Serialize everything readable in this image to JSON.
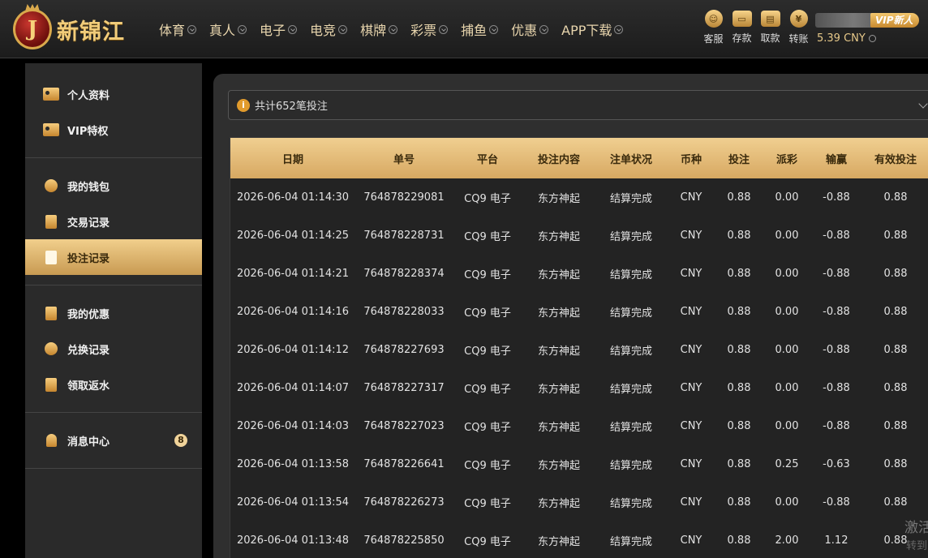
{
  "brand": {
    "logo_letter": "J",
    "name": "新锦江"
  },
  "nav": [
    {
      "label": "体育"
    },
    {
      "label": "真人"
    },
    {
      "label": "电子"
    },
    {
      "label": "电竞"
    },
    {
      "label": "棋牌"
    },
    {
      "label": "彩票"
    },
    {
      "label": "捕鱼"
    },
    {
      "label": "优惠"
    },
    {
      "label": "APP下载"
    }
  ],
  "actions": [
    {
      "label": "客服",
      "glyph": "☺"
    },
    {
      "label": "存款",
      "glyph": "▭"
    },
    {
      "label": "取款",
      "glyph": "▤"
    },
    {
      "label": "转账",
      "glyph": "¥"
    }
  ],
  "user": {
    "vip_badge": "VIP新人",
    "balance": "5.39 CNY"
  },
  "sidebar": {
    "groups": [
      [
        {
          "label": "个人资料",
          "icon": "id-card-icon"
        },
        {
          "label": "VIP特权",
          "icon": "vip-card-icon"
        }
      ],
      [
        {
          "label": "我的钱包",
          "icon": "wallet-icon"
        },
        {
          "label": "交易记录",
          "icon": "transaction-icon"
        },
        {
          "label": "投注记录",
          "icon": "bet-record-icon",
          "active": true
        }
      ],
      [
        {
          "label": "我的优惠",
          "icon": "gift-icon"
        },
        {
          "label": "兑换记录",
          "icon": "money-bag-icon"
        },
        {
          "label": "领取返水",
          "icon": "rebate-icon"
        }
      ],
      [
        {
          "label": "消息中心",
          "icon": "bell-icon",
          "badge": "8"
        }
      ]
    ]
  },
  "summary": {
    "text": "共计652笔投注",
    "info_glyph": "i"
  },
  "table": {
    "headers": [
      "日期",
      "单号",
      "平台",
      "投注内容",
      "注单状况",
      "币种",
      "投注",
      "派彩",
      "输赢",
      "有效投注"
    ],
    "rows": [
      [
        "2026-06-04 01:14:30",
        "764878229081",
        "CQ9 电子",
        "东方神起",
        "结算完成",
        "CNY",
        "0.88",
        "0.00",
        "-0.88",
        "0.88"
      ],
      [
        "2026-06-04 01:14:25",
        "764878228731",
        "CQ9 电子",
        "东方神起",
        "结算完成",
        "CNY",
        "0.88",
        "0.00",
        "-0.88",
        "0.88"
      ],
      [
        "2026-06-04 01:14:21",
        "764878228374",
        "CQ9 电子",
        "东方神起",
        "结算完成",
        "CNY",
        "0.88",
        "0.00",
        "-0.88",
        "0.88"
      ],
      [
        "2026-06-04 01:14:16",
        "764878228033",
        "CQ9 电子",
        "东方神起",
        "结算完成",
        "CNY",
        "0.88",
        "0.00",
        "-0.88",
        "0.88"
      ],
      [
        "2026-06-04 01:14:12",
        "764878227693",
        "CQ9 电子",
        "东方神起",
        "结算完成",
        "CNY",
        "0.88",
        "0.00",
        "-0.88",
        "0.88"
      ],
      [
        "2026-06-04 01:14:07",
        "764878227317",
        "CQ9 电子",
        "东方神起",
        "结算完成",
        "CNY",
        "0.88",
        "0.00",
        "-0.88",
        "0.88"
      ],
      [
        "2026-06-04 01:14:03",
        "764878227023",
        "CQ9 电子",
        "东方神起",
        "结算完成",
        "CNY",
        "0.88",
        "0.00",
        "-0.88",
        "0.88"
      ],
      [
        "2026-06-04 01:13:58",
        "764878226641",
        "CQ9 电子",
        "东方神起",
        "结算完成",
        "CNY",
        "0.88",
        "0.25",
        "-0.63",
        "0.88"
      ],
      [
        "2026-06-04 01:13:54",
        "764878226273",
        "CQ9 电子",
        "东方神起",
        "结算完成",
        "CNY",
        "0.88",
        "0.00",
        "-0.88",
        "0.88"
      ],
      [
        "2026-06-04 01:13:48",
        "764878225850",
        "CQ9 电子",
        "东方神起",
        "结算完成",
        "CNY",
        "0.88",
        "2.00",
        "1.12",
        "0.88"
      ]
    ]
  },
  "watermark": {
    "line1": "激活",
    "line2": "转到"
  },
  "colors": {
    "accent_gold": "#d7a862",
    "info_orange": "#e19b2c",
    "background": "#000000",
    "panel": "#2f2f2f"
  }
}
